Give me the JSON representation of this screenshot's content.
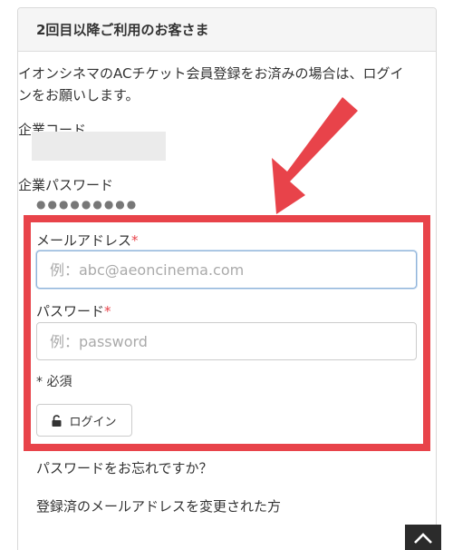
{
  "card": {
    "title": "2回目以降ご利用のお客さま",
    "intro": "イオンシネマのACチケット会員登録をお済みの場合は、ログインをお願いします。"
  },
  "company": {
    "code_label": "企業コード",
    "password_label": "企業パスワード",
    "password_value": "●●●●●●●●●"
  },
  "form": {
    "email_label": "メールアドレス",
    "email_placeholder": "例：abc@aeoncinema.com",
    "password_label": "パスワード",
    "password_placeholder": "例：password",
    "required_mark": "*",
    "required_note": "* 必須",
    "login_label": "ログイン"
  },
  "links": {
    "forgot_password": "パスワードをお忘れですか？",
    "changed_email": "登録済のメールアドレスを変更された方"
  },
  "icons": {
    "lock": "lock-icon",
    "arrow": "arrow-annotation",
    "back_to_top": "chevron-up-icon"
  },
  "colors": {
    "highlight": "#e8434a",
    "required": "#e8434a",
    "header_bg": "#f5f5f5",
    "focus_border": "#8fb3d9"
  }
}
